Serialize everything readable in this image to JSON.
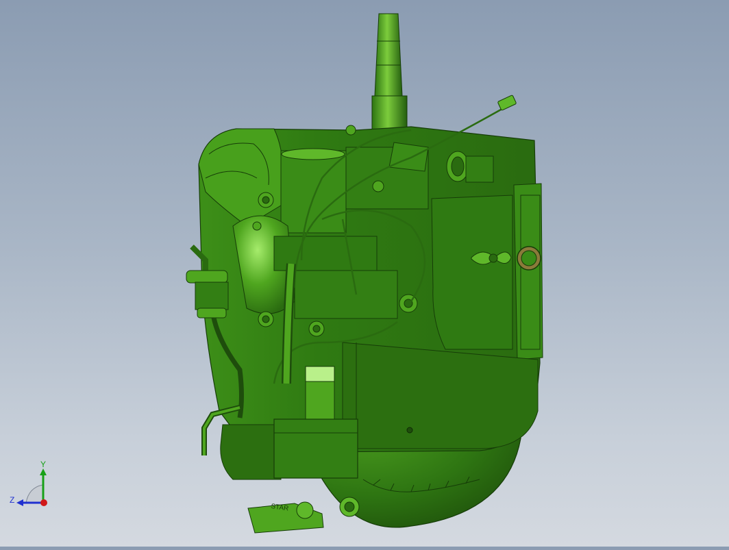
{
  "viewport": {
    "background_top": "#8b9cb2",
    "background_bottom": "#d4d9e0"
  },
  "model": {
    "color_dark": "#1e4d0c",
    "color_mid": "#2f7a12",
    "color_light": "#5fb82a",
    "color_highlight": "#b9f08a",
    "tag_text": "STAR"
  },
  "triad": {
    "y_label": "Y",
    "z_label": "Z",
    "y_color": "#18a018",
    "z_color": "#2030d0",
    "x_color": "#d01818"
  }
}
